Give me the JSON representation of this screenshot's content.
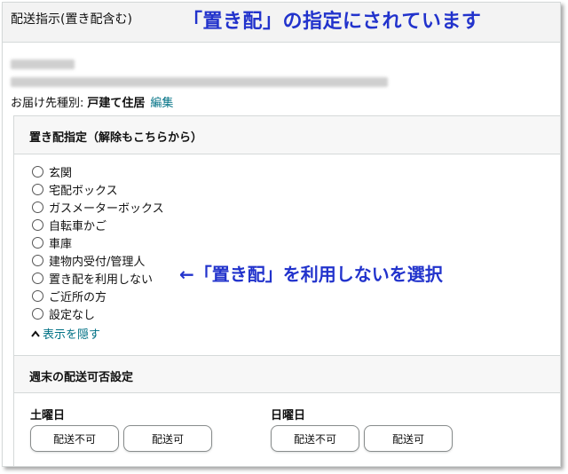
{
  "header": {
    "title": "配送指示(置き配含む)",
    "annotation": "「置き配」の指定にされています"
  },
  "address": {
    "type_label": "お届け先種別:",
    "type_value": "戸建て住居",
    "edit_label": "編集"
  },
  "delivery_place": {
    "heading": "置き配指定（解除もこちらから）",
    "options": [
      {
        "label": "玄関"
      },
      {
        "label": "宅配ボックス"
      },
      {
        "label": "ガスメーターボックス"
      },
      {
        "label": "自転車かご"
      },
      {
        "label": "車庫"
      },
      {
        "label": "建物内受付/管理人"
      },
      {
        "label": "置き配を利用しない"
      },
      {
        "label": "ご近所の方"
      },
      {
        "label": "設定なし"
      }
    ],
    "toggle_label": "表示を隠す",
    "annotation": "←「置き配」を利用しないを選択"
  },
  "weekend": {
    "heading": "週末の配送可否設定",
    "saturday": {
      "label": "土曜日",
      "no_label": "配送不可",
      "yes_label": "配送可"
    },
    "sunday": {
      "label": "日曜日",
      "no_label": "配送不可",
      "yes_label": "配送可"
    }
  },
  "icons": {
    "caret": "chevron-up-icon"
  },
  "colors": {
    "annotation": "#2233cc",
    "link": "#007185"
  }
}
